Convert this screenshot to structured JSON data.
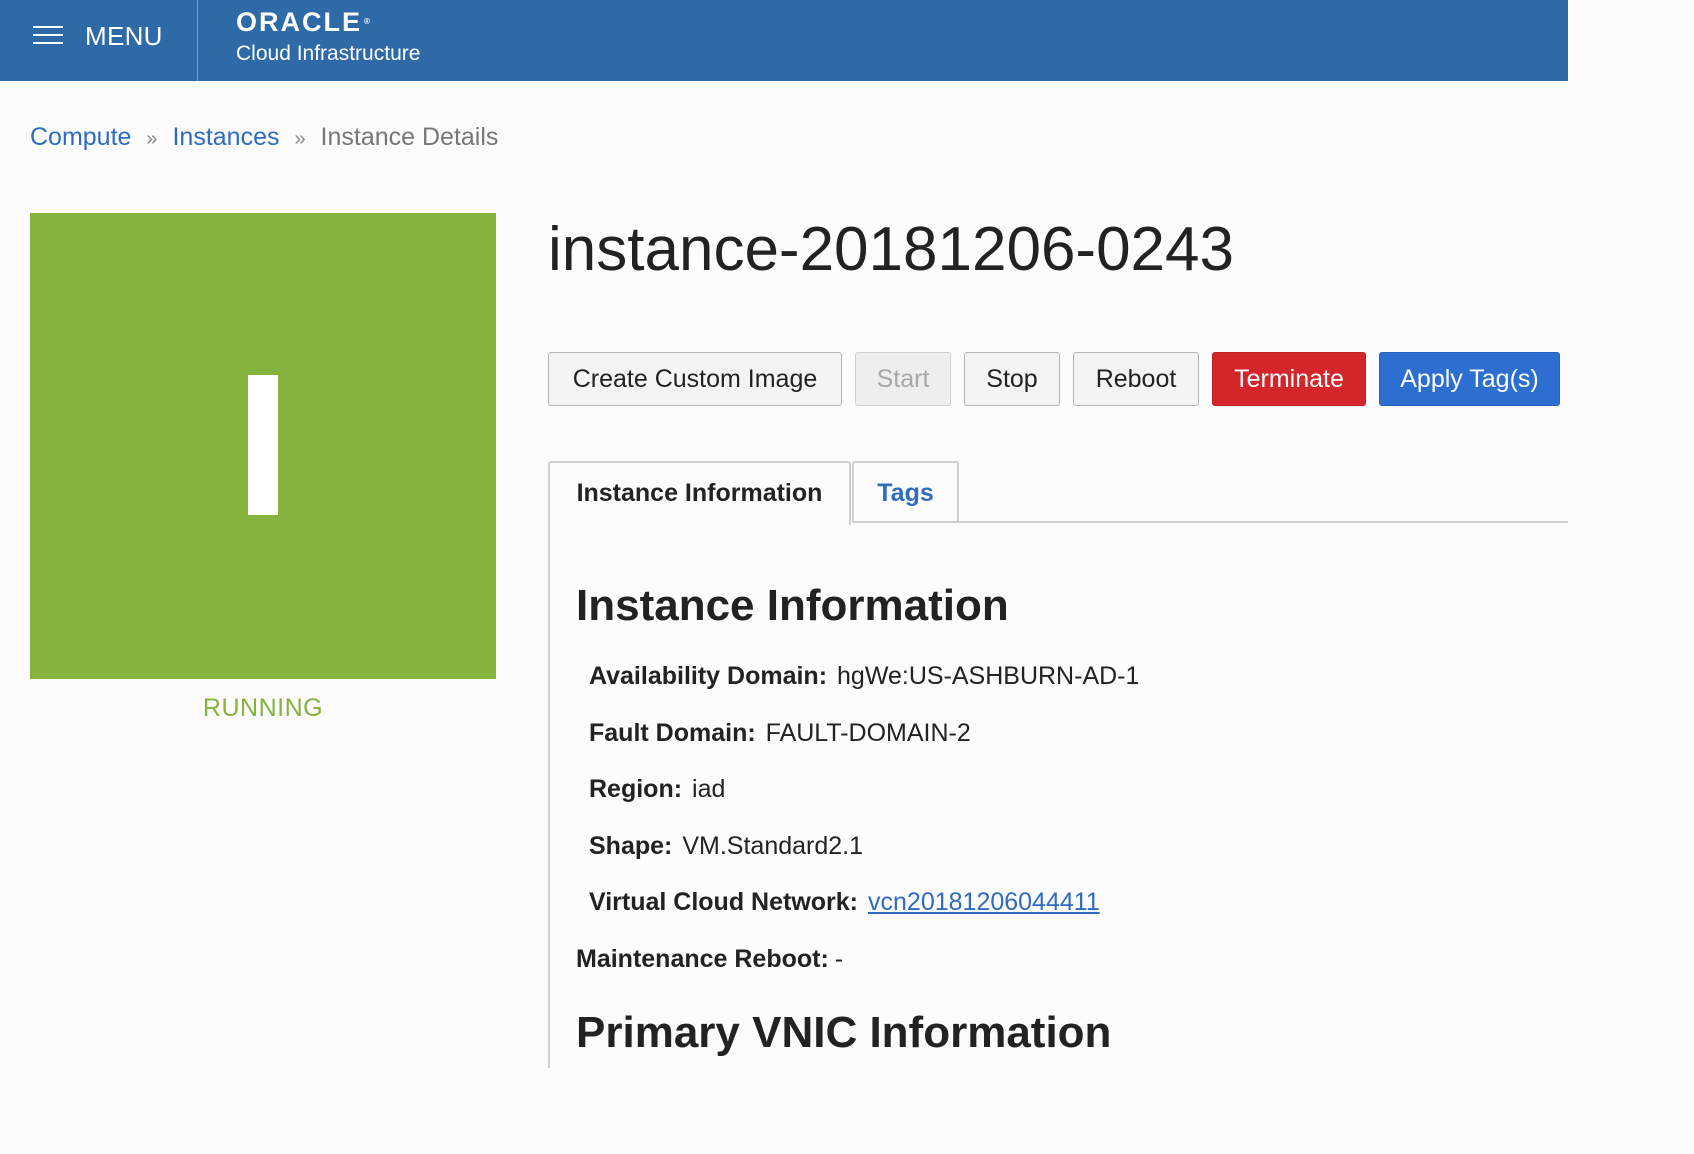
{
  "header": {
    "menu_label": "MENU",
    "brand_name": "ORACLE",
    "brand_sub": "Cloud Infrastructure"
  },
  "breadcrumb": {
    "items": [
      "Compute",
      "Instances"
    ],
    "separator": "»",
    "current": "Instance Details"
  },
  "instance": {
    "initial": "I",
    "status": "RUNNING",
    "name": "instance-20181206-0243",
    "status_color": "#85b33e"
  },
  "actions": {
    "create_custom_image": "Create Custom Image",
    "start": "Start",
    "stop": "Stop",
    "reboot": "Reboot",
    "terminate": "Terminate",
    "apply_tags": "Apply Tag(s)"
  },
  "tabs": {
    "instance_information": "Instance Information",
    "tags": "Tags"
  },
  "instance_information": {
    "title": "Instance Information",
    "availability_domain_label": "Availability Domain:",
    "availability_domain_value": "hgWe:US-ASHBURN-AD-1",
    "fault_domain_label": "Fault Domain:",
    "fault_domain_value": "FAULT-DOMAIN-2",
    "region_label": "Region:",
    "region_value": "iad",
    "shape_label": "Shape:",
    "shape_value": "VM.Standard2.1",
    "vcn_label": "Virtual Cloud Network:",
    "vcn_value": "vcn20181206044411",
    "maintenance_reboot_label": "Maintenance Reboot:",
    "maintenance_reboot_value": "-"
  },
  "primary_vnic": {
    "title": "Primary VNIC Information"
  },
  "colors": {
    "header_bg": "#2f6aa8",
    "link": "#2f6bbf",
    "terminate": "#d4262a",
    "apply": "#2d6fd1"
  }
}
